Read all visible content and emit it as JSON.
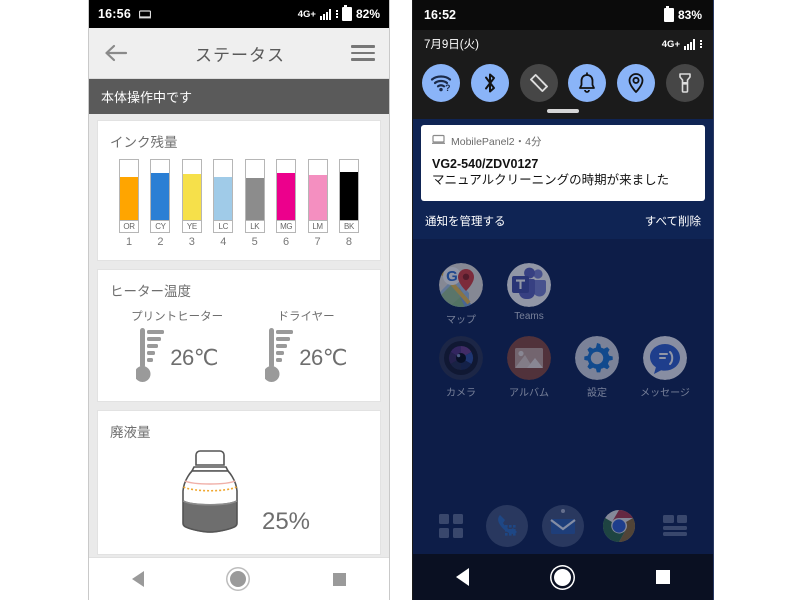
{
  "left_phone": {
    "status_bar": {
      "time": "16:56",
      "keyboard_icon": "keyboard-icon",
      "network": "4G+",
      "signal_icon": "signal-bars-icon",
      "battery_icon": "battery-icon",
      "battery": "82%"
    },
    "app_bar": {
      "back_icon": "back-arrow-icon",
      "title": "ステータス",
      "menu_icon": "hamburger-menu-icon"
    },
    "banner": "本体操作中です",
    "ink_card": {
      "title": "インク残量",
      "items": [
        {
          "code": "OR",
          "number": "1",
          "color": "#FFA500",
          "level": 72
        },
        {
          "code": "CY",
          "number": "2",
          "color": "#2B7FD4",
          "level": 78
        },
        {
          "code": "YE",
          "number": "3",
          "color": "#F6E04A",
          "level": 77
        },
        {
          "code": "LC",
          "number": "4",
          "color": "#A0CBE8",
          "level": 72
        },
        {
          "code": "LK",
          "number": "5",
          "color": "#8C8C8C",
          "level": 70
        },
        {
          "code": "MG",
          "number": "6",
          "color": "#EC008C",
          "level": 78
        },
        {
          "code": "LM",
          "number": "7",
          "color": "#F48FC0",
          "level": 75
        },
        {
          "code": "BK",
          "number": "8",
          "color": "#000000",
          "level": 80
        }
      ]
    },
    "heater_card": {
      "title": "ヒーター温度",
      "items": [
        {
          "label": "プリントヒーター",
          "value": "26℃",
          "icon": "thermometer-icon"
        },
        {
          "label": "ドライヤー",
          "value": "26℃",
          "icon": "thermometer-icon"
        }
      ]
    },
    "waste_card": {
      "title": "廃液量",
      "icon": "waste-bottle-icon",
      "value": "25%",
      "level": 25
    },
    "nav_bar": {
      "back_icon": "nav-back-icon",
      "home_icon": "nav-home-icon",
      "recents_icon": "nav-recents-icon"
    }
  },
  "right_phone": {
    "status_bar": {
      "time": "16:52",
      "battery_icon": "battery-icon",
      "battery": "83%"
    },
    "date_bar": {
      "date": "7月9日(火)",
      "network": "4G+",
      "signal_icon": "signal-bars-icon"
    },
    "quick_settings": {
      "tiles": [
        {
          "name": "wifi-icon",
          "label": "Wi-Fi",
          "state": "on"
        },
        {
          "name": "bluetooth-icon",
          "label": "Bluetooth",
          "state": "on"
        },
        {
          "name": "auto-rotate-icon",
          "label": "自動回転",
          "state": "off"
        },
        {
          "name": "bell-icon",
          "label": "通知",
          "state": "on"
        },
        {
          "name": "location-icon",
          "label": "位置情報",
          "state": "on"
        },
        {
          "name": "flashlight-icon",
          "label": "ライト",
          "state": "off"
        }
      ],
      "handle_icon": "drag-handle-icon"
    },
    "notification": {
      "app_icon": "mobile-panel-icon",
      "app_name": "MobilePanel2・4分",
      "title": "VG2-540/ZDV0127",
      "body": "マニュアルクリーニングの時期が来ました",
      "manage_label": "通知を管理する",
      "clear_all_label": "すべて削除"
    },
    "home_screen": {
      "apps": [
        [
          {
            "label": "マップ",
            "icon": "google-maps-icon"
          },
          {
            "label": "Teams",
            "icon": "microsoft-teams-icon"
          }
        ],
        [
          {
            "label": "カメラ",
            "icon": "camera-icon"
          },
          {
            "label": "アルバム",
            "icon": "album-icon"
          },
          {
            "label": "設定",
            "icon": "settings-gear-icon"
          },
          {
            "label": "メッセージ",
            "icon": "messages-icon"
          }
        ]
      ],
      "page_indicator_icon": "page-dot-icon",
      "dock": [
        {
          "name": "app-drawer-icon"
        },
        {
          "name": "phone-dialer-icon"
        },
        {
          "name": "email-icon"
        },
        {
          "name": "chrome-icon"
        },
        {
          "name": "news-icon"
        }
      ]
    },
    "nav_bar": {
      "back_icon": "nav-back-icon",
      "home_icon": "nav-home-icon",
      "recents_icon": "nav-recents-icon"
    }
  },
  "colors": {
    "accent_blue": "#8ab4f8",
    "home_bg": "#0f2454",
    "banner_gray": "#5a5a5a"
  }
}
